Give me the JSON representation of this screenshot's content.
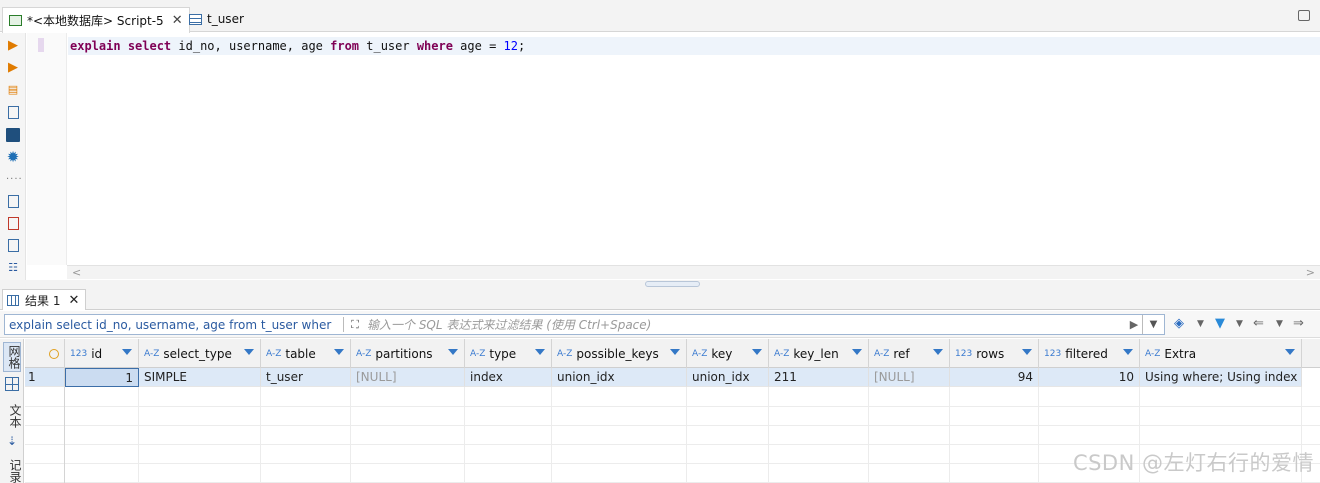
{
  "tabs": [
    {
      "label": "*<本地数据库> Script-5",
      "icon": "sql-script-icon",
      "active": true
    },
    {
      "label": "t_user",
      "icon": "table-icon",
      "active": false
    }
  ],
  "editor": {
    "sql_tokens": [
      {
        "t": "explain",
        "k": true
      },
      {
        "t": " "
      },
      {
        "t": "select",
        "k": true
      },
      {
        "t": " id_no, username, age "
      },
      {
        "t": "from",
        "k": true
      },
      {
        "t": " t_user "
      },
      {
        "t": "where",
        "k": true
      },
      {
        "t": " age = "
      },
      {
        "t": "12",
        "n": true
      },
      {
        "t": ";"
      }
    ]
  },
  "results": {
    "tab_label": "结果 1",
    "filter_sql": "explain select id_no, username, age from t_user wher",
    "filter_placeholder": "输入一个 SQL 表达式来过滤结果 (使用 Ctrl+Space)",
    "side_labels": [
      "网格",
      "文本",
      "记录"
    ],
    "columns": [
      {
        "name": "id",
        "type": "123"
      },
      {
        "name": "select_type",
        "type": "A-Z"
      },
      {
        "name": "table",
        "type": "A-Z"
      },
      {
        "name": "partitions",
        "type": "A-Z"
      },
      {
        "name": "type",
        "type": "A-Z"
      },
      {
        "name": "possible_keys",
        "type": "A-Z"
      },
      {
        "name": "key",
        "type": "A-Z"
      },
      {
        "name": "key_len",
        "type": "A-Z"
      },
      {
        "name": "ref",
        "type": "A-Z"
      },
      {
        "name": "rows",
        "type": "123"
      },
      {
        "name": "filtered",
        "type": "123"
      },
      {
        "name": "Extra",
        "type": "A-Z"
      }
    ],
    "rows": [
      {
        "num": "1",
        "cells": [
          "1",
          "SIMPLE",
          "t_user",
          "[NULL]",
          "index",
          "union_idx",
          "union_idx",
          "211",
          "[NULL]",
          "94",
          "10",
          "Using where; Using index"
        ]
      }
    ]
  },
  "watermark": "CSDN @左灯右行的爱情"
}
